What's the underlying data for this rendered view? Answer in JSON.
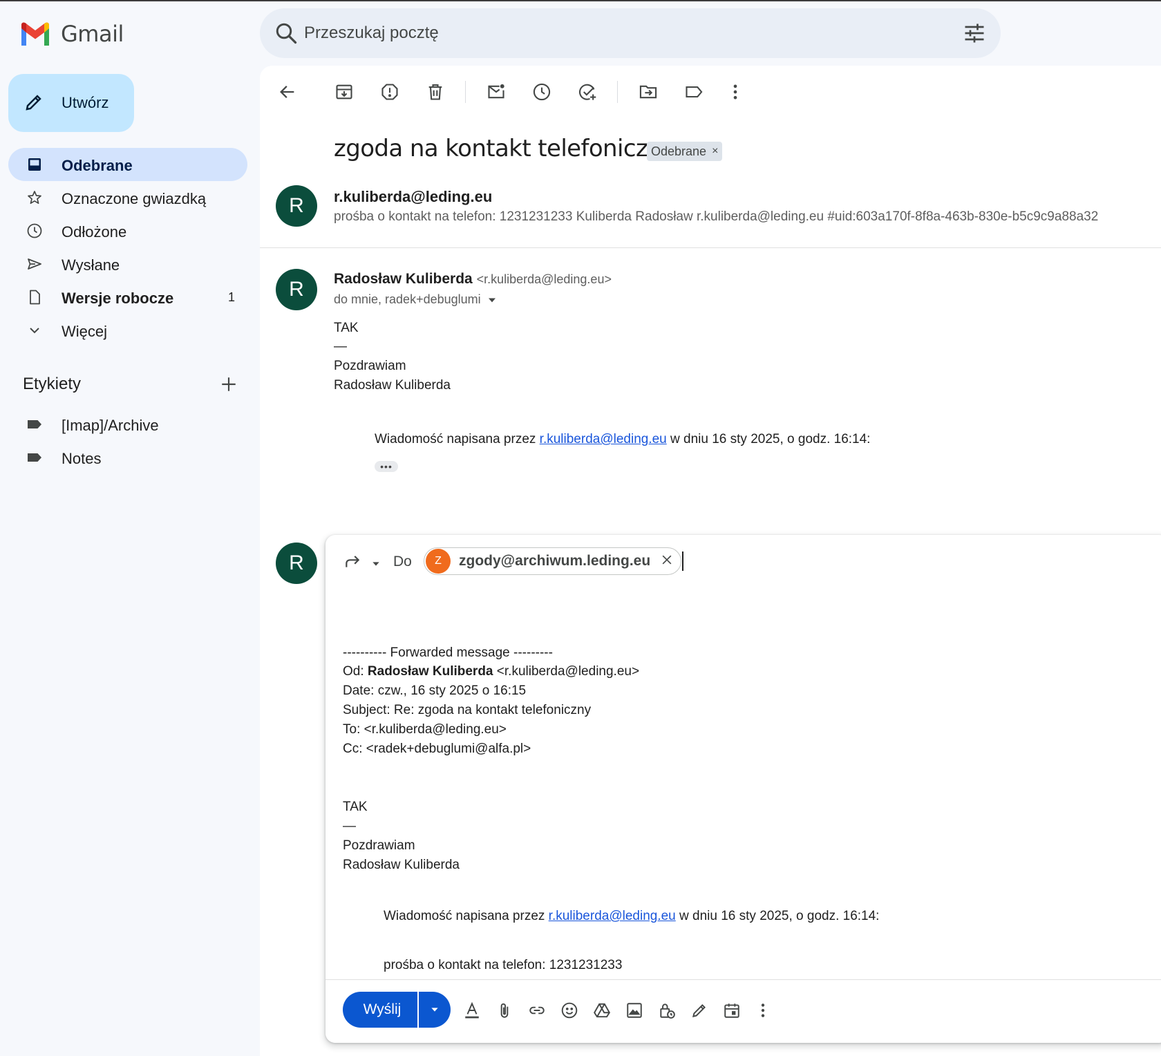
{
  "app": {
    "name": "Gmail"
  },
  "search": {
    "placeholder": "Przeszukaj pocztę"
  },
  "sidebar": {
    "compose_label": "Utwórz",
    "items": [
      {
        "label": "Odebrane",
        "icon": "inbox-icon",
        "active": true
      },
      {
        "label": "Oznaczone gwiazdką",
        "icon": "star-icon"
      },
      {
        "label": "Odłożone",
        "icon": "clock-icon"
      },
      {
        "label": "Wysłane",
        "icon": "send-icon"
      },
      {
        "label": "Wersje robocze",
        "icon": "draft-icon",
        "count": "1"
      },
      {
        "label": "Więcej",
        "icon": "chevron-down-icon"
      }
    ],
    "labels_title": "Etykiety",
    "labels": [
      {
        "label": "[Imap]/Archive",
        "icon": "label-icon"
      },
      {
        "label": "Notes",
        "icon": "label-icon"
      }
    ]
  },
  "toolbar": {
    "icons": [
      "back-arrow-icon",
      "archive-icon",
      "report-spam-icon",
      "delete-icon",
      "mark-unread-icon",
      "snooze-icon",
      "add-task-icon",
      "move-to-icon",
      "label-as-icon",
      "more-vert-icon"
    ]
  },
  "thread": {
    "subject": "zgoda na kontakt telefoniczny",
    "label_chip": "Odebrane",
    "label_chip_close": "×",
    "collapsed_message": {
      "avatar_letter": "R",
      "from": "r.kuliberda@leding.eu",
      "snippet": "prośba o kontakt na telefon: 1231231233 Kuliberda Radosław r.kuliberda@leding.eu #uid:603a170f-8f8a-463b-830e-b5c9c9a88a32"
    },
    "message": {
      "avatar_letter": "R",
      "sender_name": "Radosław Kuliberda",
      "sender_addr": "<r.kuliberda@leding.eu>",
      "recipients": "do mnie, radek+debuglumi",
      "body_lines": [
        "TAK",
        "—",
        "Pozdrawiam",
        "Radosław Kuliberda"
      ],
      "quote_prefix": "Wiadomość napisana przez ",
      "quote_link": "r.kuliberda@leding.eu",
      "quote_suffix": " w dniu 16 sty 2025, o godz. 16:14:",
      "ellipsis": "•••"
    }
  },
  "reply": {
    "avatar_letter": "R",
    "to_label": "Do",
    "to_chip_letter": "Z",
    "to_address": "zgody@archiwum.leding.eu",
    "forwarded_header": "---------- Forwarded message ---------",
    "od_label": "Od: ",
    "od_name": "Radosław Kuliberda",
    "od_addr": " <r.kuliberda@leding.eu>",
    "date_line": "Date: czw., 16 sty 2025 o 16:15",
    "subject_line": "Subject: Re: zgoda na kontakt telefoniczny",
    "to_line": "To: <r.kuliberda@leding.eu>",
    "cc_line": "Cc: <radek+debuglumi@alfa.pl>",
    "body_lines": [
      "TAK",
      "—",
      "Pozdrawiam",
      "Radosław Kuliberda"
    ],
    "quote_prefix": "Wiadomość napisana przez ",
    "quote_link": "r.kuliberda@leding.eu",
    "quote_suffix": " w dniu 16 sty 2025, o godz. 16:14:",
    "cut_line": "prośba o kontakt na telefon: 1231231233",
    "send_label": "Wyślij",
    "footer_icons": [
      "formatting-icon",
      "attach-icon",
      "link-icon",
      "emoji-icon",
      "drive-icon",
      "photo-icon",
      "confidential-icon",
      "signature-icon",
      "schedule-icon",
      "more-options-icon"
    ]
  },
  "colors": {
    "accent": "#0b57d0",
    "avatar": "#0b4d3c",
    "chip_avatar": "#f06b1d",
    "active_nav": "#d3e3fd",
    "compose": "#c2e7ff"
  }
}
